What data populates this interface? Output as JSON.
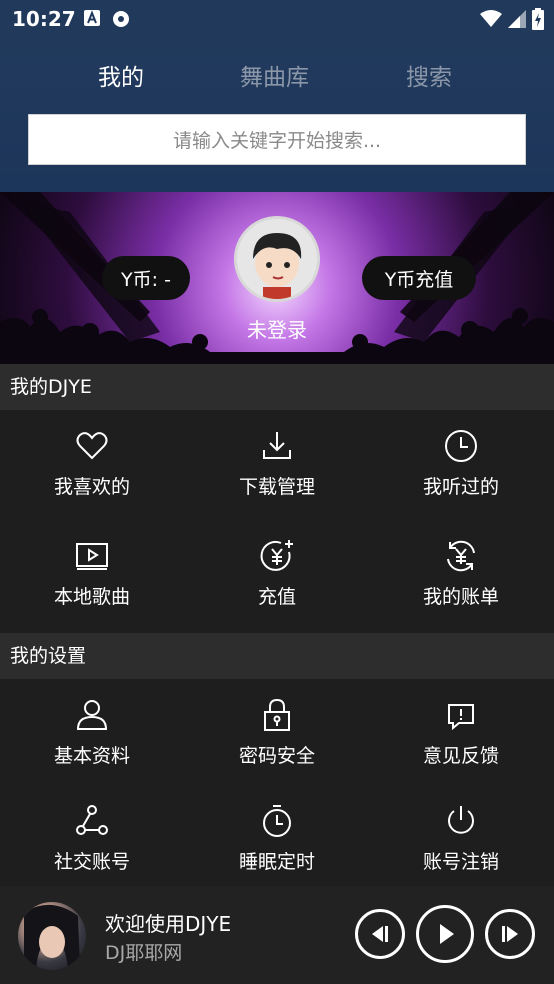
{
  "status_bar": {
    "time": "10:27"
  },
  "tabs": [
    {
      "label": "我的",
      "active": true
    },
    {
      "label": "舞曲库",
      "active": false
    },
    {
      "label": "搜索",
      "active": false
    }
  ],
  "search": {
    "placeholder": "请输入关键字开始搜索..."
  },
  "banner": {
    "coin_label": "Y币: -",
    "recharge_label": "Y币充值",
    "login_status": "未登录"
  },
  "sections": {
    "my_djye": {
      "title": "我的DJYE",
      "items": [
        {
          "label": "我喜欢的",
          "icon": "heart-icon"
        },
        {
          "label": "下载管理",
          "icon": "download-icon"
        },
        {
          "label": "我听过的",
          "icon": "clock-icon"
        },
        {
          "label": "本地歌曲",
          "icon": "video-icon"
        },
        {
          "label": "充值",
          "icon": "yen-plus-icon"
        },
        {
          "label": "我的账单",
          "icon": "yen-cycle-icon"
        }
      ]
    },
    "my_settings": {
      "title": "我的设置",
      "items": [
        {
          "label": "基本资料",
          "icon": "user-icon"
        },
        {
          "label": "密码安全",
          "icon": "lock-icon"
        },
        {
          "label": "意见反馈",
          "icon": "feedback-icon"
        },
        {
          "label": "社交账号",
          "icon": "share-icon"
        },
        {
          "label": "睡眠定时",
          "icon": "timer-icon"
        },
        {
          "label": "账号注销",
          "icon": "power-icon"
        }
      ]
    }
  },
  "player": {
    "title": "欢迎使用DJYE",
    "subtitle": "DJ耶耶网"
  },
  "colors": {
    "header_bg": "#213a5c",
    "panel_bg": "#1e1e1e",
    "section_bg": "#2d2d2d",
    "inactive_tab": "#8b97a8"
  }
}
